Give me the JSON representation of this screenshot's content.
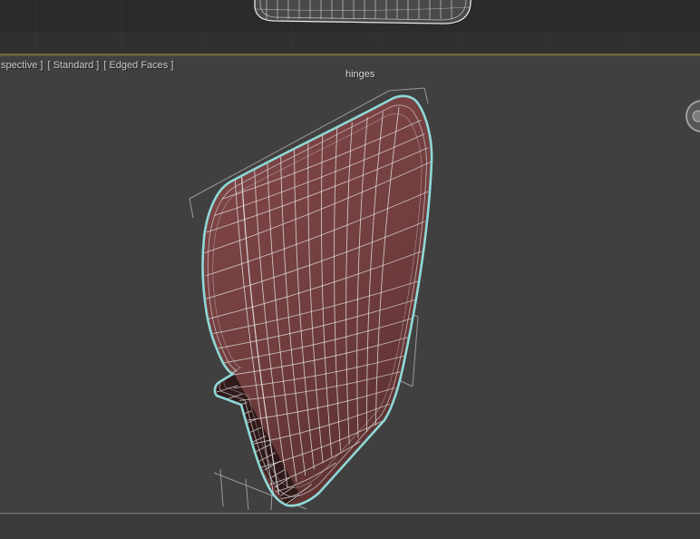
{
  "main_viewport": {
    "label_pov_truncated": "spective ]",
    "label_render_preset": "[ Standard ]",
    "label_shading": "[ Edged Faces ]",
    "object_label": "hinges"
  },
  "colors": {
    "selection_outline_cyan": "#8ed9d7",
    "object_fill_maroon": "#7a4242",
    "active_viewport_border": "#6c693e",
    "viewport_background": "#404040",
    "top_viewport_background": "#303030",
    "wireframe_line": "#e9e9e9"
  }
}
